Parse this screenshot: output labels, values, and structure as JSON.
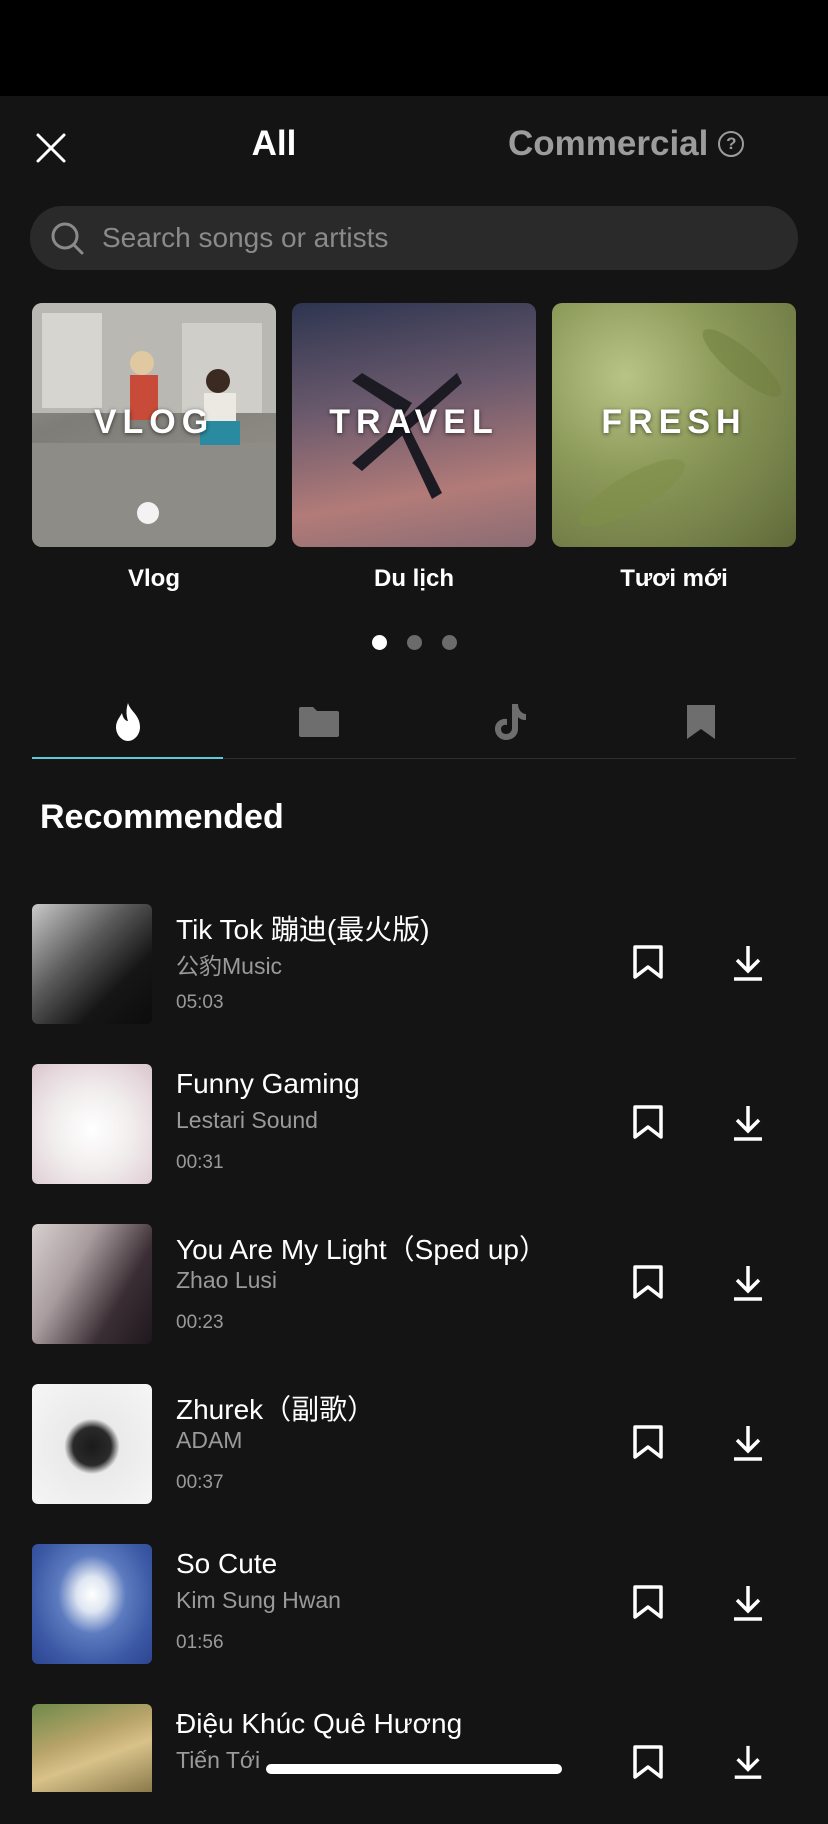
{
  "header": {
    "close_icon": "close-icon",
    "tab_all": "All",
    "tab_commercial": "Commercial",
    "help_icon": "?"
  },
  "search": {
    "placeholder": "Search songs or artists"
  },
  "genres": [
    {
      "title": "VLOG",
      "caption": "Vlog"
    },
    {
      "title": "TRAVEL",
      "caption": "Du lịch"
    },
    {
      "title": "FRESH",
      "caption": "Tươi mới"
    }
  ],
  "pager": {
    "pages": 3,
    "active": 1
  },
  "category_tabs": [
    "flame-icon",
    "folder-icon",
    "tiktok-icon",
    "bookmark-icon"
  ],
  "section": {
    "title": "Recommended"
  },
  "songs": [
    {
      "title": "Tik Tok 蹦迪(最火版)",
      "artist": "公豹Music",
      "duration": "05:03"
    },
    {
      "title": "Funny Gaming",
      "artist": "Lestari Sound",
      "duration": "00:31"
    },
    {
      "title": "You Are My Light（Sped up）",
      "artist": "Zhao Lusi",
      "duration": "00:23"
    },
    {
      "title": "Zhurek（副歌）",
      "artist": "ADAM",
      "duration": "00:37"
    },
    {
      "title": "So Cute",
      "artist": "Kim Sung Hwan",
      "duration": "01:56"
    },
    {
      "title": "Điệu Khúc Quê Hương",
      "artist": "Tiến Tới",
      "duration": ""
    }
  ],
  "colors": {
    "background": "#141414",
    "accent": "#5ec9d8",
    "muted": "#9a9a9a"
  }
}
